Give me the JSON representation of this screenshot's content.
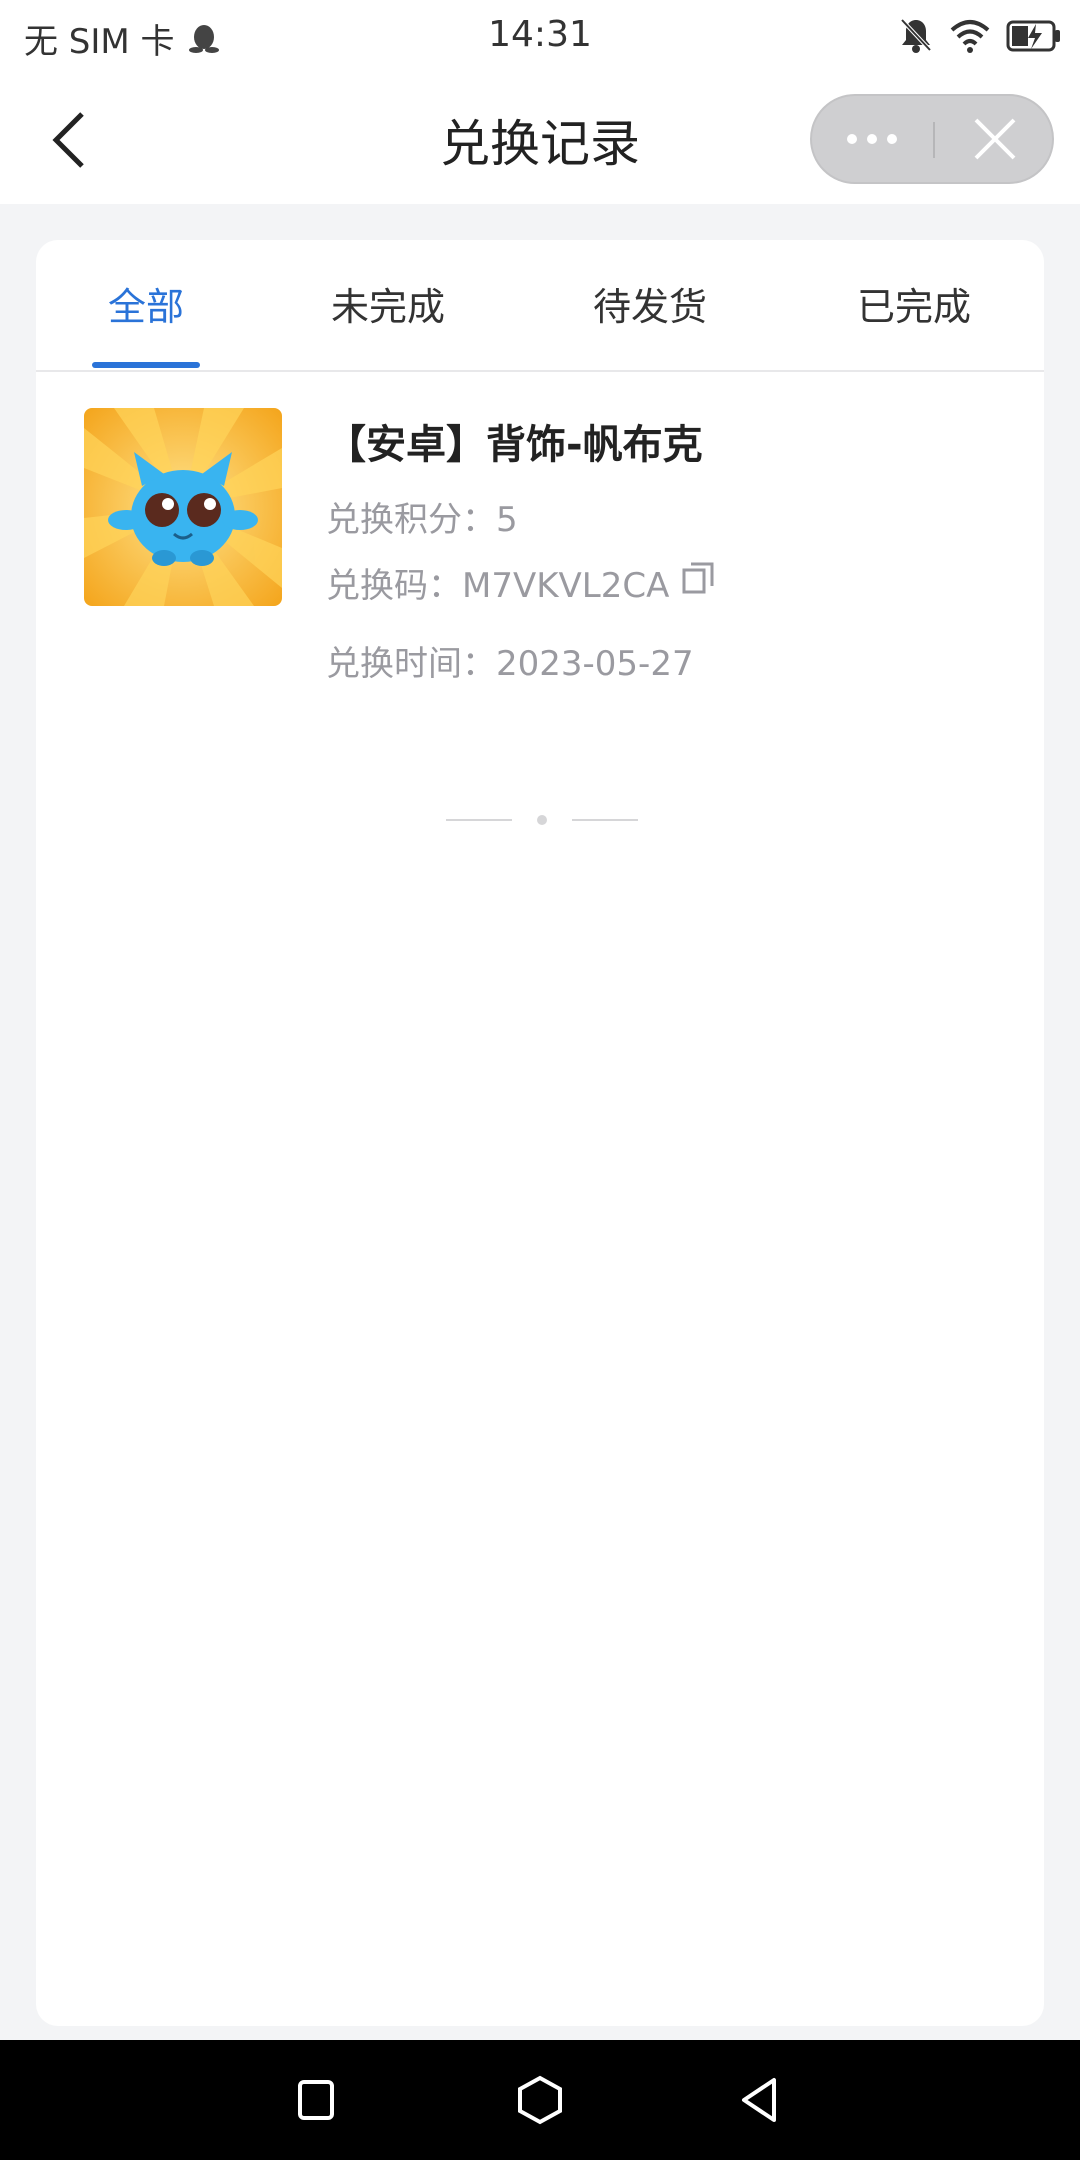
{
  "status": {
    "carrier": "无 SIM 卡",
    "time": "14:31",
    "icons": [
      "qq-icon",
      "mute-bell-icon",
      "wifi-icon",
      "battery-charging-icon"
    ]
  },
  "header": {
    "title": "兑换记录",
    "back_icon": "chevron-left-icon",
    "more_icon": "more-dots-icon",
    "close_icon": "close-icon"
  },
  "tabs": [
    {
      "label": "全部",
      "active": true
    },
    {
      "label": "未完成",
      "active": false
    },
    {
      "label": "待发货",
      "active": false
    },
    {
      "label": "已完成",
      "active": false
    }
  ],
  "records": [
    {
      "title": "【安卓】背饰-帆布克",
      "points_label": "兑换积分：",
      "points": "5",
      "code_label": "兑换码：",
      "code": "M7VKVL2CA",
      "time_label": "兑换时间：",
      "time": "2023-05-27"
    }
  ],
  "colors": {
    "accent": "#2a73d8",
    "background": "#f3f4f6",
    "secondary_text": "#9a9aa0"
  },
  "navbar": [
    "square-icon",
    "hexagon-home-icon",
    "triangle-back-icon"
  ]
}
